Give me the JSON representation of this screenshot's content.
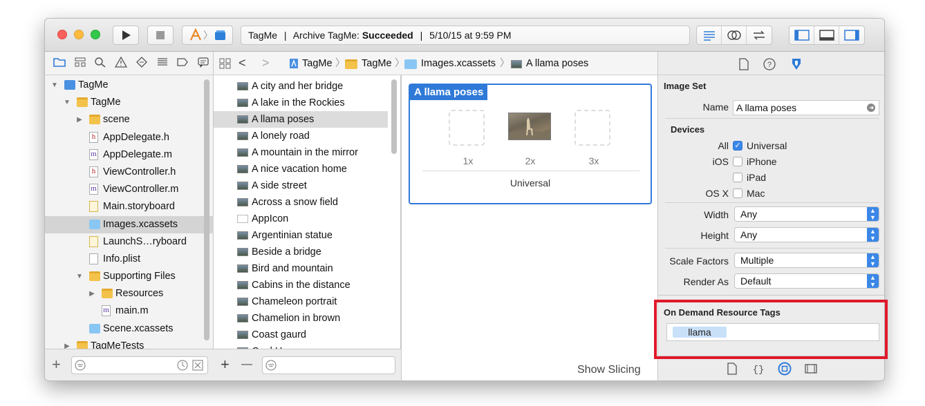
{
  "toolbar": {
    "run_icon": "play-icon",
    "stop_icon": "stop-icon",
    "scheme_icon": "xcode-app-icon",
    "device_icon": "device-icon",
    "activity": {
      "project": "TagMe",
      "sep1": "|",
      "action": "Archive TagMe:",
      "status": "Succeeded",
      "sep2": "|",
      "timestamp": "5/10/15 at 9:59 PM"
    },
    "editor_modes": [
      "standard-editor-icon",
      "assistant-editor-icon",
      "version-editor-icon"
    ],
    "view_toggles": [
      "navigator-toggle-icon",
      "debug-area-toggle-icon",
      "utilities-toggle-icon"
    ]
  },
  "navigator": {
    "tabs": [
      "folder-icon",
      "hierarchy-icon",
      "search-icon",
      "warning-icon",
      "test-icon",
      "debug-icon",
      "breakpoint-icon",
      "report-icon"
    ],
    "tree": [
      {
        "label": "TagMe",
        "level": 0,
        "expanded": "open",
        "kind": "project"
      },
      {
        "label": "TagMe",
        "level": 1,
        "expanded": "open",
        "kind": "folder"
      },
      {
        "label": "scene",
        "level": 2,
        "expanded": "closed",
        "kind": "folder"
      },
      {
        "label": "AppDelegate.h",
        "level": 2,
        "expanded": "",
        "kind": "h"
      },
      {
        "label": "AppDelegate.m",
        "level": 2,
        "expanded": "",
        "kind": "m"
      },
      {
        "label": "ViewController.h",
        "level": 2,
        "expanded": "",
        "kind": "h"
      },
      {
        "label": "ViewController.m",
        "level": 2,
        "expanded": "",
        "kind": "m"
      },
      {
        "label": "Main.storyboard",
        "level": 2,
        "expanded": "",
        "kind": "storyboard"
      },
      {
        "label": "Images.xcassets",
        "level": 2,
        "expanded": "",
        "kind": "xcassets",
        "selected": true
      },
      {
        "label": "LaunchS…ryboard",
        "level": 2,
        "expanded": "",
        "kind": "storyboard"
      },
      {
        "label": "Info.plist",
        "level": 2,
        "expanded": "",
        "kind": "plist"
      },
      {
        "label": "Supporting Files",
        "level": 2,
        "expanded": "open",
        "kind": "folder"
      },
      {
        "label": "Resources",
        "level": 3,
        "expanded": "closed",
        "kind": "folder"
      },
      {
        "label": "main.m",
        "level": 3,
        "expanded": "",
        "kind": "m"
      },
      {
        "label": "Scene.xcassets",
        "level": 2,
        "expanded": "",
        "kind": "xcassets"
      },
      {
        "label": "TagMeTests",
        "level": 1,
        "expanded": "closed",
        "kind": "folder"
      }
    ],
    "footer": {
      "add": "+",
      "filter_icon": "filter-icon",
      "recent_icon": "clock-icon",
      "scm_icon": "scm-filter-icon"
    }
  },
  "jumpbar": {
    "grid_icon": "related-items-icon",
    "back": "<",
    "forward": ">",
    "crumbs": [
      "TagMe",
      "TagMe",
      "Images.xcassets",
      "A llama poses"
    ]
  },
  "assets": {
    "items": [
      "A city and her bridge",
      "A lake in the Rockies",
      "A llama poses",
      "A lonely road",
      "A mountain in the mirror",
      "A nice vacation home",
      "A side street",
      "Across a snow field",
      "AppIcon",
      "Argentinian statue",
      "Beside a bridge",
      "Bird and mountain",
      "Cabins in the distance",
      "Chameleon portrait",
      "Chamelion in brown",
      "Coast gaurd",
      "Cool House"
    ],
    "selected_index": 2,
    "footer": {
      "add": "+",
      "remove": "—"
    }
  },
  "editor": {
    "title": "A llama poses",
    "slots": [
      "1x",
      "2x",
      "3x"
    ],
    "group_label": "Universal",
    "show_slicing": "Show Slicing"
  },
  "inspector": {
    "tabs": [
      "file-icon",
      "help-icon",
      "attributes-icon"
    ],
    "section_title": "Image Set",
    "name_label": "Name",
    "name_value": "A llama poses",
    "devices_title": "Devices",
    "devices": [
      {
        "group": "All",
        "label": "Universal",
        "checked": true
      },
      {
        "group": "iOS",
        "label": "iPhone",
        "checked": false
      },
      {
        "group": "",
        "label": "iPad",
        "checked": false
      },
      {
        "group": "OS X",
        "label": "Mac",
        "checked": false
      }
    ],
    "width_label": "Width",
    "width_value": "Any",
    "height_label": "Height",
    "height_value": "Any",
    "scale_label": "Scale Factors",
    "scale_value": "Multiple",
    "render_label": "Render As",
    "render_value": "Default",
    "odr_title": "On Demand Resource Tags",
    "odr_tags": [
      "llama"
    ],
    "library_tabs": [
      "file-template-icon",
      "code-snippet-icon",
      "object-library-icon",
      "media-library-icon"
    ]
  },
  "colors": {
    "accent": "#2f7ad8",
    "highlight_border": "#e0192b"
  }
}
